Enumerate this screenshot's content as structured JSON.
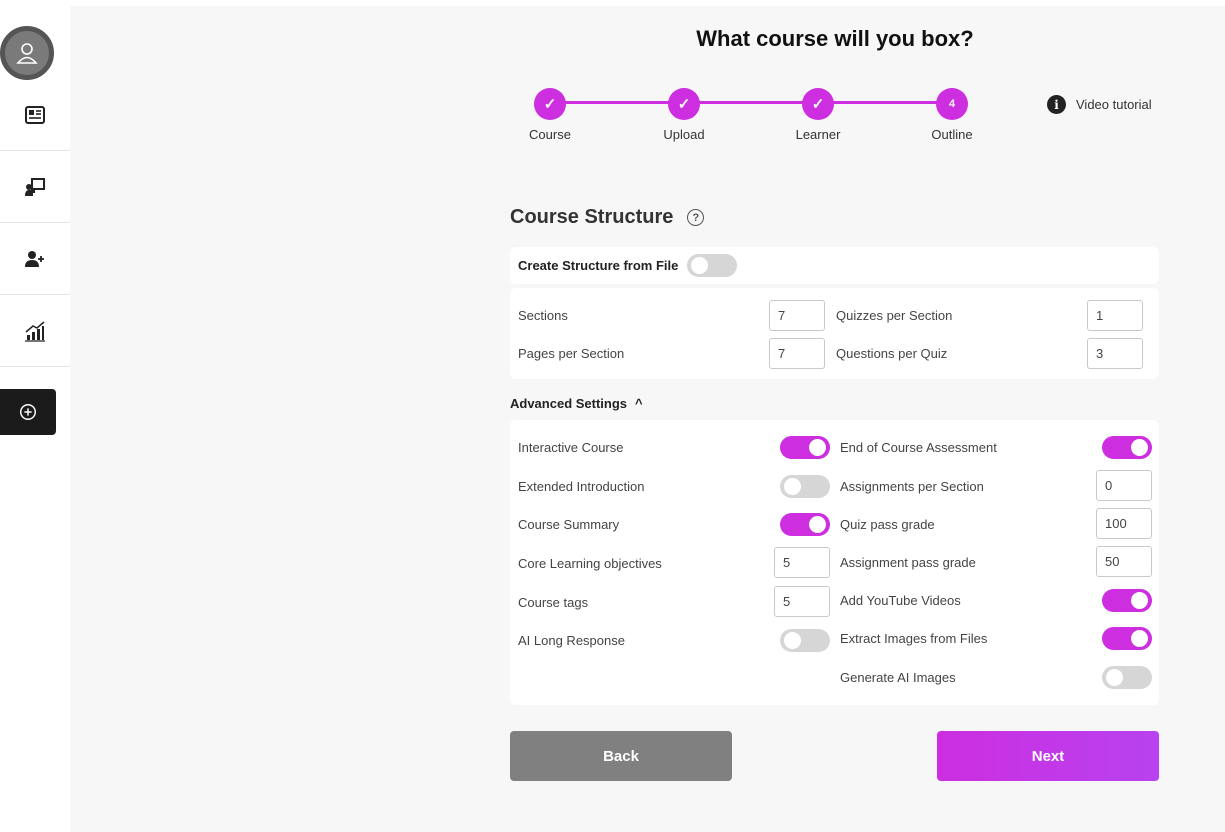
{
  "title": "What course will you box?",
  "steps": [
    {
      "label": "Course",
      "marker": "✓"
    },
    {
      "label": "Upload",
      "marker": "✓"
    },
    {
      "label": "Learner",
      "marker": "✓"
    },
    {
      "label": "Outline",
      "marker": "4"
    }
  ],
  "video_tutorial": "Video tutorial",
  "section_title": "Course Structure",
  "create_from_file": {
    "label": "Create Structure from File",
    "on": false
  },
  "structure": {
    "sections": {
      "label": "Sections",
      "value": "7"
    },
    "quizzes_per_section": {
      "label": "Quizzes per Section",
      "value": "1"
    },
    "pages_per_section": {
      "label": "Pages per Section",
      "value": "7"
    },
    "questions_per_quiz": {
      "label": "Questions per Quiz",
      "value": "3"
    }
  },
  "advanced_label": "Advanced Settings",
  "advanced": {
    "left": [
      {
        "label": "Interactive Course",
        "type": "toggle",
        "on": true
      },
      {
        "label": "Extended Introduction",
        "type": "toggle",
        "on": false
      },
      {
        "label": "Course Summary",
        "type": "toggle",
        "on": true
      },
      {
        "label": "Core Learning objectives",
        "type": "input",
        "value": "5"
      },
      {
        "label": "Course tags",
        "type": "input",
        "value": "5"
      },
      {
        "label": "AI Long Response",
        "type": "toggle",
        "on": false
      }
    ],
    "right": [
      {
        "label": "End of Course Assessment",
        "type": "toggle",
        "on": true
      },
      {
        "label": "Assignments per Section",
        "type": "input",
        "value": "0"
      },
      {
        "label": "Quiz pass grade",
        "type": "input",
        "value": "100"
      },
      {
        "label": "Assignment pass grade",
        "type": "input",
        "value": "50"
      },
      {
        "label": "Add YouTube Videos",
        "type": "toggle",
        "on": true
      },
      {
        "label": "Extract Images from Files",
        "type": "toggle",
        "on": true
      },
      {
        "label": "Generate AI Images",
        "type": "toggle",
        "on": false
      }
    ]
  },
  "buttons": {
    "back": "Back",
    "next": "Next"
  },
  "colors": {
    "accent": "#cc2ee0",
    "back_button": "#808080",
    "toggle_off": "#d6d6d6"
  }
}
